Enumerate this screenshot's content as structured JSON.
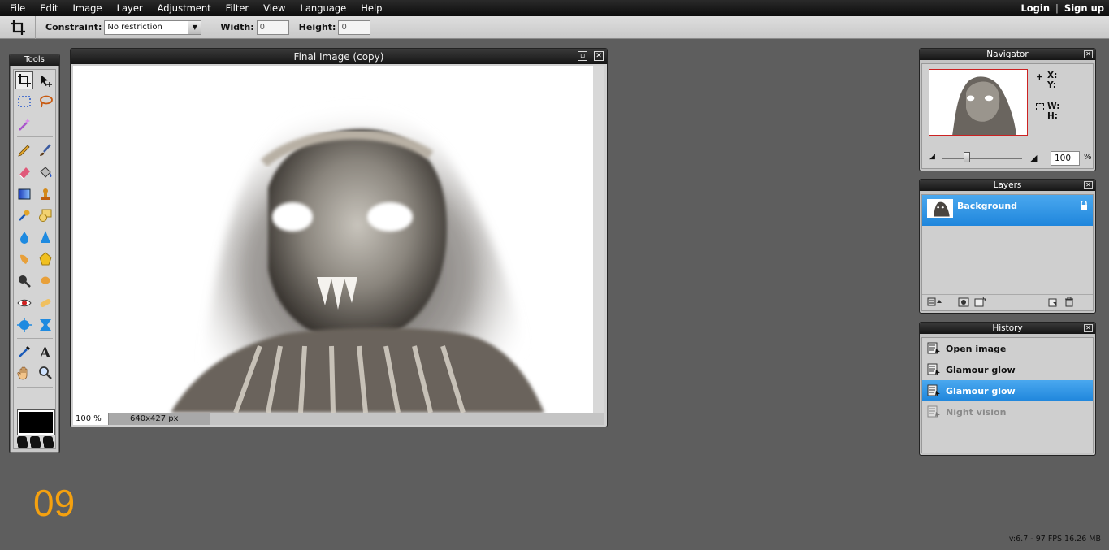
{
  "menubar": {
    "items": [
      "File",
      "Edit",
      "Image",
      "Layer",
      "Adjustment",
      "Filter",
      "View",
      "Language",
      "Help"
    ],
    "login": "Login",
    "separator": "|",
    "signup": "Sign up"
  },
  "options": {
    "constraint_label": "Constraint:",
    "constraint_value": "No restriction",
    "width_label": "Width:",
    "width_value": "0",
    "height_label": "Height:",
    "height_value": "0"
  },
  "tools": {
    "title": "Tools",
    "icons": [
      "crop-icon",
      "move-icon",
      "marquee-icon",
      "lasso-icon",
      "magic-wand-icon",
      "pencil-icon",
      "brush-icon",
      "eraser-icon",
      "paint-bucket-icon",
      "gradient-icon",
      "clone-stamp-icon",
      "color-replace-icon",
      "drawing-icon",
      "blur-icon",
      "sharpen-icon",
      "smudge-icon",
      "sponge-icon",
      "dodge-icon",
      "burn-icon",
      "red-eye-icon",
      "spot-heal-icon",
      "bloat-icon",
      "pinch-icon",
      "color-picker-icon",
      "type-icon",
      "hand-icon",
      "zoom-icon"
    ],
    "foreground_color": "#000000"
  },
  "image_window": {
    "title": "Final Image (copy)",
    "zoom": "100",
    "zoom_unit": "%",
    "dimensions": "640x427 px"
  },
  "navigator": {
    "title": "Navigator",
    "x_label": "X:",
    "y_label": "Y:",
    "w_label": "W:",
    "h_label": "H:",
    "zoom_value": "100",
    "zoom_unit": "%"
  },
  "layers": {
    "title": "Layers",
    "items": [
      {
        "name": "Background",
        "locked": true,
        "selected": true
      }
    ]
  },
  "history": {
    "title": "History",
    "items": [
      {
        "label": "Open image",
        "state": "done"
      },
      {
        "label": "Glamour glow",
        "state": "done"
      },
      {
        "label": "Glamour glow",
        "state": "active"
      },
      {
        "label": "Night vision",
        "state": "undone"
      }
    ]
  },
  "footer": {
    "number": "09",
    "version": "v:6.7 - 97 FPS 16.26 MB"
  },
  "colors": {
    "accent_blue": "#2a8fe0",
    "background": "#5e5e5e",
    "footer_orange": "#f5a10f"
  }
}
